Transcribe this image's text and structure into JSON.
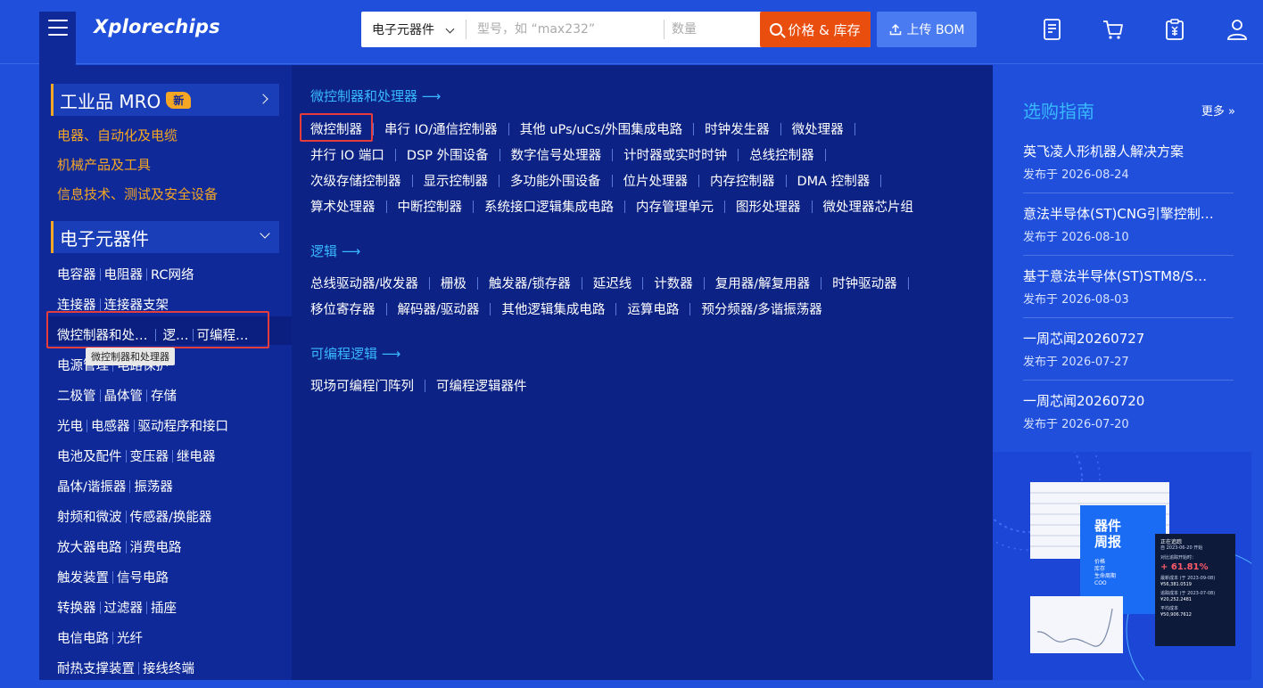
{
  "header": {
    "logo": "Xplorechips",
    "search": {
      "category": "电子元器件",
      "part_placeholder": "型号，如 “max232”",
      "qty_placeholder": "数量",
      "search_label": "价格 & 库存"
    },
    "bom_label": "上传 BOM"
  },
  "sidebar": {
    "mro_title": "工业品 MRO",
    "mro_badge": "新",
    "mro_links": [
      "电器、自动化及电缆",
      "机械产品及工具",
      "信息技术、测试及安全设备"
    ],
    "components_title": "电子元器件",
    "rows": [
      [
        "电容器",
        "电阻器",
        "RC网络"
      ],
      [
        "连接器",
        "连接器支架"
      ],
      [
        "微控制器和处…",
        "逻…",
        "可编程…"
      ],
      [
        "电源管理",
        "电路保护"
      ],
      [
        "二极管",
        "晶体管",
        "存储"
      ],
      [
        "光电",
        "电感器",
        "驱动程序和接口"
      ],
      [
        "电池及配件",
        "变压器",
        "继电器"
      ],
      [
        "晶体/谐振器",
        "振荡器"
      ],
      [
        "射频和微波",
        "传感器/换能器"
      ],
      [
        "放大器电路",
        "消费电路"
      ],
      [
        "触发装置",
        "信号电路"
      ],
      [
        "转换器",
        "过滤器",
        "插座"
      ],
      [
        "电信电路",
        "光纤"
      ],
      [
        "耐热支撑装置",
        "接线终端"
      ]
    ],
    "tooltip": "微控制器和处理器"
  },
  "middle": {
    "sections": [
      {
        "title": "微控制器和处理器 ⟶",
        "lines": [
          [
            "微控制器",
            "串行 IO/通信控制器",
            "其他 uPs/uCs/外围集成电路",
            "时钟发生器",
            "微处理器",
            ""
          ],
          [
            "并行 IO 端口",
            "DSP 外围设备",
            "数字信号处理器",
            "计时器或实时时钟",
            "总线控制器",
            ""
          ],
          [
            "次级存储控制器",
            "显示控制器",
            "多功能外围设备",
            "位片处理器",
            "内存控制器",
            "DMA 控制器",
            ""
          ],
          [
            "算术处理器",
            "中断控制器",
            "系统接口逻辑集成电路",
            "内存管理单元",
            "图形处理器",
            "微处理器芯片组"
          ]
        ]
      },
      {
        "title": "逻辑 ⟶",
        "lines": [
          [
            "总线驱动器/收发器",
            "栅极",
            "触发器/锁存器",
            "延迟线",
            "计数器",
            "复用器/解复用器",
            "时钟驱动器",
            ""
          ],
          [
            "移位寄存器",
            "解码器/驱动器",
            "其他逻辑集成电路",
            "运算电路",
            "预分频器/多谐振荡器"
          ]
        ]
      },
      {
        "title": "可编程逻辑 ⟶",
        "lines": [
          [
            "现场可编程门阵列",
            "可编程逻辑器件"
          ]
        ]
      }
    ]
  },
  "guide": {
    "title": "选购指南",
    "more": "更多 »",
    "items": [
      {
        "title": "英飞凌人形机器人解决方案",
        "date": "发布于 2026-08-24"
      },
      {
        "title": "意法半导体(ST)CNG引擎控制…",
        "date": "发布于 2026-08-10"
      },
      {
        "title": "基于意法半导体(ST)STM8/S…",
        "date": "发布于 2026-08-03"
      },
      {
        "title": "一周芯闻20260727",
        "date": "发布于 2026-07-27"
      },
      {
        "title": "一周芯闻20260720",
        "date": "发布于 2026-07-20"
      }
    ]
  },
  "promo": {
    "title_line1": "器件",
    "title_line2": "周报",
    "tags": [
      "价格",
      "库存",
      "生命周期",
      "COO"
    ],
    "card_title": "正在追踪",
    "card_sub": "自 2023-06-20 开始",
    "card_label1": "对比追踪开始时：",
    "card_change": "+ 61.81%",
    "card_label2": "最新成本 (于 2023-09-08)",
    "card_val1": "¥56,381.0519",
    "card_label3": "追踪成本 (于 2023-07-08)",
    "card_val2": "¥20,252.2481",
    "card_label4": "平均成本",
    "card_val3": "¥50,906.7612"
  },
  "colors": {
    "header_bg": "#1f4fdb",
    "sidebar_bg": "#0f2a98",
    "panel_bg": "#0c2285",
    "accent_orange": "#f5a623",
    "link_blue": "#38b8ff",
    "search_btn": "#e94e0f",
    "highlight_red": "#e63c3c"
  }
}
